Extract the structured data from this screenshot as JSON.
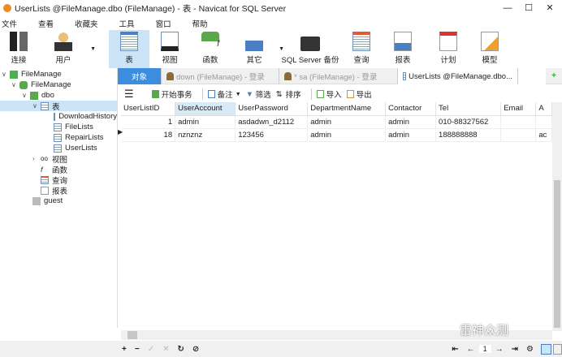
{
  "window": {
    "title": "UserLists @FileManage.dbo (FileManage) - 表 - Navicat for SQL Server",
    "minimize": "—",
    "maximize": "☐",
    "close": "✕"
  },
  "menu": [
    "文件",
    "查看",
    "收藏夹",
    "工具",
    "窗口",
    "帮助"
  ],
  "toolbar": [
    {
      "label": "连接",
      "icon": "connect-icon"
    },
    {
      "label": "用户",
      "icon": "user-icon"
    },
    {
      "label": "表",
      "icon": "table-icon"
    },
    {
      "label": "视图",
      "icon": "view-icon"
    },
    {
      "label": "函数",
      "icon": "function-icon"
    },
    {
      "label": "其它",
      "icon": "other-icon"
    },
    {
      "label": "SQL Server 备份",
      "icon": "backup-icon"
    },
    {
      "label": "查询",
      "icon": "query-icon"
    },
    {
      "label": "报表",
      "icon": "report-icon"
    },
    {
      "label": "计划",
      "icon": "schedule-icon"
    },
    {
      "label": "模型",
      "icon": "model-icon"
    }
  ],
  "tree": {
    "conn": "FileManage",
    "db": "FileManage",
    "schema": "dbo",
    "tables_label": "表",
    "tables": [
      "DownloadHistory",
      "FileLists",
      "RepairLists",
      "UserLists"
    ],
    "views": "视图",
    "functions": "函数",
    "queries": "查询",
    "reports": "报表",
    "guest": "guest"
  },
  "tabs": {
    "objects": "对象",
    "tab1": "down (FileManage) - 登录",
    "tab2": "* sa (FileManage) - 登录",
    "tab3": "UserLists @FileManage.dbo..."
  },
  "subtoolbar": {
    "begin": "开始事务",
    "memo": "备注",
    "filter": "筛选",
    "sort": "排序",
    "import": "导入",
    "export": "导出"
  },
  "grid": {
    "columns": [
      "UserListID",
      "UserAccount",
      "UserPassword",
      "DepartmentName",
      "Contactor",
      "Tel",
      "Email",
      "A"
    ],
    "rows": [
      [
        "1",
        "admin",
        "asdadwn_d2112",
        "admin",
        "admin",
        "010-88327562",
        "",
        ""
      ],
      [
        "18",
        "nznznz",
        "123456",
        "admin",
        "admin",
        "188888888",
        "",
        "ac"
      ]
    ]
  },
  "pager": {
    "page": "1"
  },
  "watermark": "雷神众测"
}
